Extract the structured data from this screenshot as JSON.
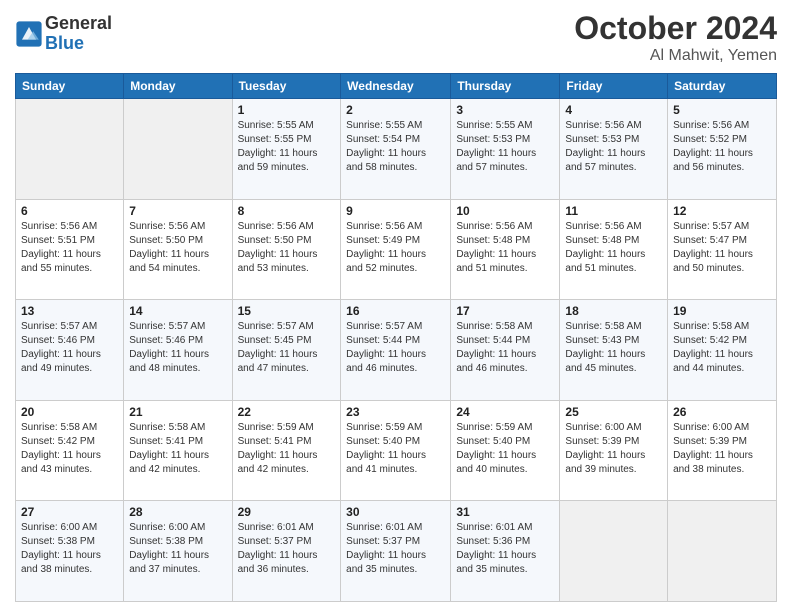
{
  "header": {
    "logo_line1": "General",
    "logo_line2": "Blue",
    "month": "October 2024",
    "location": "Al Mahwit, Yemen"
  },
  "days_of_week": [
    "Sunday",
    "Monday",
    "Tuesday",
    "Wednesday",
    "Thursday",
    "Friday",
    "Saturday"
  ],
  "weeks": [
    [
      {
        "day": "",
        "info": ""
      },
      {
        "day": "",
        "info": ""
      },
      {
        "day": "1",
        "info": "Sunrise: 5:55 AM\nSunset: 5:55 PM\nDaylight: 11 hours and 59 minutes."
      },
      {
        "day": "2",
        "info": "Sunrise: 5:55 AM\nSunset: 5:54 PM\nDaylight: 11 hours and 58 minutes."
      },
      {
        "day": "3",
        "info": "Sunrise: 5:55 AM\nSunset: 5:53 PM\nDaylight: 11 hours and 57 minutes."
      },
      {
        "day": "4",
        "info": "Sunrise: 5:56 AM\nSunset: 5:53 PM\nDaylight: 11 hours and 57 minutes."
      },
      {
        "day": "5",
        "info": "Sunrise: 5:56 AM\nSunset: 5:52 PM\nDaylight: 11 hours and 56 minutes."
      }
    ],
    [
      {
        "day": "6",
        "info": "Sunrise: 5:56 AM\nSunset: 5:51 PM\nDaylight: 11 hours and 55 minutes."
      },
      {
        "day": "7",
        "info": "Sunrise: 5:56 AM\nSunset: 5:50 PM\nDaylight: 11 hours and 54 minutes."
      },
      {
        "day": "8",
        "info": "Sunrise: 5:56 AM\nSunset: 5:50 PM\nDaylight: 11 hours and 53 minutes."
      },
      {
        "day": "9",
        "info": "Sunrise: 5:56 AM\nSunset: 5:49 PM\nDaylight: 11 hours and 52 minutes."
      },
      {
        "day": "10",
        "info": "Sunrise: 5:56 AM\nSunset: 5:48 PM\nDaylight: 11 hours and 51 minutes."
      },
      {
        "day": "11",
        "info": "Sunrise: 5:56 AM\nSunset: 5:48 PM\nDaylight: 11 hours and 51 minutes."
      },
      {
        "day": "12",
        "info": "Sunrise: 5:57 AM\nSunset: 5:47 PM\nDaylight: 11 hours and 50 minutes."
      }
    ],
    [
      {
        "day": "13",
        "info": "Sunrise: 5:57 AM\nSunset: 5:46 PM\nDaylight: 11 hours and 49 minutes."
      },
      {
        "day": "14",
        "info": "Sunrise: 5:57 AM\nSunset: 5:46 PM\nDaylight: 11 hours and 48 minutes."
      },
      {
        "day": "15",
        "info": "Sunrise: 5:57 AM\nSunset: 5:45 PM\nDaylight: 11 hours and 47 minutes."
      },
      {
        "day": "16",
        "info": "Sunrise: 5:57 AM\nSunset: 5:44 PM\nDaylight: 11 hours and 46 minutes."
      },
      {
        "day": "17",
        "info": "Sunrise: 5:58 AM\nSunset: 5:44 PM\nDaylight: 11 hours and 46 minutes."
      },
      {
        "day": "18",
        "info": "Sunrise: 5:58 AM\nSunset: 5:43 PM\nDaylight: 11 hours and 45 minutes."
      },
      {
        "day": "19",
        "info": "Sunrise: 5:58 AM\nSunset: 5:42 PM\nDaylight: 11 hours and 44 minutes."
      }
    ],
    [
      {
        "day": "20",
        "info": "Sunrise: 5:58 AM\nSunset: 5:42 PM\nDaylight: 11 hours and 43 minutes."
      },
      {
        "day": "21",
        "info": "Sunrise: 5:58 AM\nSunset: 5:41 PM\nDaylight: 11 hours and 42 minutes."
      },
      {
        "day": "22",
        "info": "Sunrise: 5:59 AM\nSunset: 5:41 PM\nDaylight: 11 hours and 42 minutes."
      },
      {
        "day": "23",
        "info": "Sunrise: 5:59 AM\nSunset: 5:40 PM\nDaylight: 11 hours and 41 minutes."
      },
      {
        "day": "24",
        "info": "Sunrise: 5:59 AM\nSunset: 5:40 PM\nDaylight: 11 hours and 40 minutes."
      },
      {
        "day": "25",
        "info": "Sunrise: 6:00 AM\nSunset: 5:39 PM\nDaylight: 11 hours and 39 minutes."
      },
      {
        "day": "26",
        "info": "Sunrise: 6:00 AM\nSunset: 5:39 PM\nDaylight: 11 hours and 38 minutes."
      }
    ],
    [
      {
        "day": "27",
        "info": "Sunrise: 6:00 AM\nSunset: 5:38 PM\nDaylight: 11 hours and 38 minutes."
      },
      {
        "day": "28",
        "info": "Sunrise: 6:00 AM\nSunset: 5:38 PM\nDaylight: 11 hours and 37 minutes."
      },
      {
        "day": "29",
        "info": "Sunrise: 6:01 AM\nSunset: 5:37 PM\nDaylight: 11 hours and 36 minutes."
      },
      {
        "day": "30",
        "info": "Sunrise: 6:01 AM\nSunset: 5:37 PM\nDaylight: 11 hours and 35 minutes."
      },
      {
        "day": "31",
        "info": "Sunrise: 6:01 AM\nSunset: 5:36 PM\nDaylight: 11 hours and 35 minutes."
      },
      {
        "day": "",
        "info": ""
      },
      {
        "day": "",
        "info": ""
      }
    ]
  ]
}
